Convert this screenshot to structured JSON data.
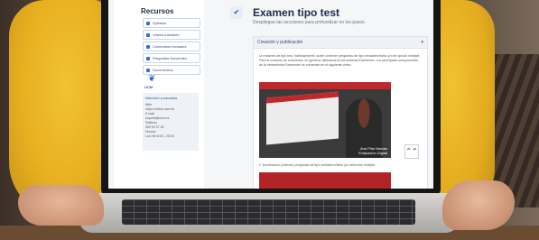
{
  "sidebar": {
    "title": "Recursos",
    "items": [
      {
        "label": "Syllabus",
        "icon": "list-icon"
      },
      {
        "label": "Videos tutoriales",
        "icon": "video-icon"
      },
      {
        "label": "Contenidos textuales",
        "icon": "text-icon"
      },
      {
        "label": "Preguntas frecuentes",
        "icon": "question-icon"
      },
      {
        "label": "Documentos",
        "icon": "document-icon"
      }
    ],
    "logo_text": "UCM",
    "contact": {
      "heading": "Atención a usuarios",
      "lines": [
        "Web",
        "https://online.ucm.es",
        "E-mail",
        "soporte@ucm.es",
        "Teléfono",
        "900 00 37 25",
        "Horario",
        "Lun-Vie 8:00 - 20:00"
      ]
    }
  },
  "main": {
    "check_icon": "✔",
    "title": "Examen tipo test",
    "subtitle": "Despliegue las secciones para profundizar en los pasos.",
    "card": {
      "heading": "Creación y publicación",
      "paragraph": "Un examen de tipo test, habitualmente, suele contener preguntas de tipo verdadero/falso y/o de opción múltiple. Para la creación de exámenes, en general, utilizamos la herramienta Exámenes. Los principales componentes de la herramienta Exámenes se comentan en el siguiente vídeo.",
      "video_caption_line1": "Ana Pilar Macias",
      "video_caption_line2": "Evaluación Digital",
      "step2": "2. Escribamos (ordenar) preguntas de tipo verdadero/falso y/o selección múltiple."
    },
    "scroll_top_icon": "⌃⌃"
  },
  "colors": {
    "accent": "#2f4f86",
    "video_red": "#c0282c",
    "sweater_yellow": "#f1c232"
  }
}
